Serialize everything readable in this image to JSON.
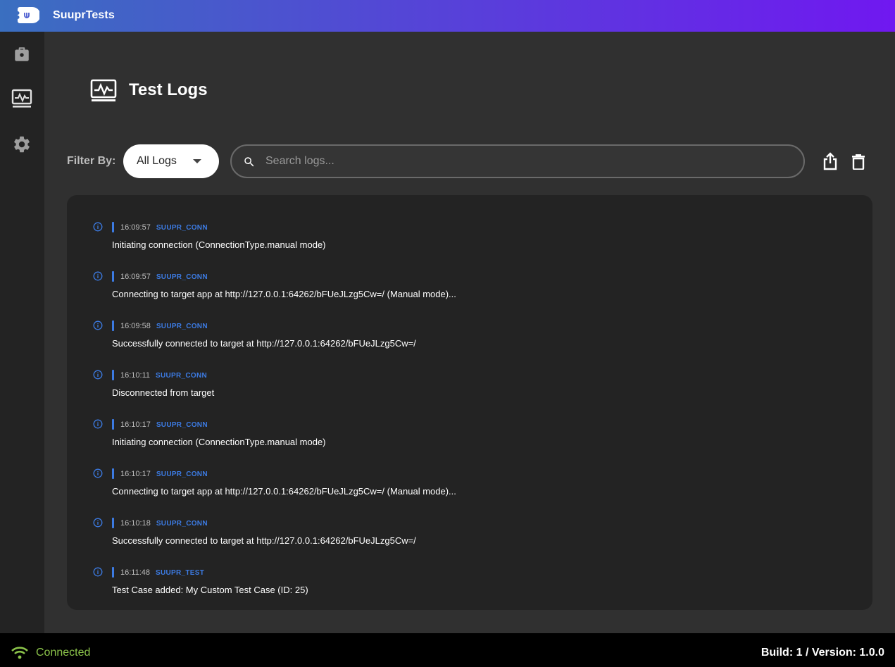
{
  "app": {
    "title": "SuuprTests",
    "accent": "#3c7be3",
    "gradient_start": "#3a6fc0",
    "gradient_end": "#7018f0"
  },
  "sidebar": {
    "items": [
      {
        "name": "test-cases",
        "icon": "briefcase-icon",
        "active": false
      },
      {
        "name": "test-logs",
        "icon": "monitor-heart-icon",
        "active": true
      },
      {
        "name": "settings",
        "icon": "gear-icon",
        "active": false
      }
    ]
  },
  "page": {
    "title": "Test Logs",
    "icon": "monitor-heart-icon"
  },
  "toolbar": {
    "filter_label": "Filter By:",
    "filter_value": "All Logs",
    "search_placeholder": "Search logs...",
    "search_value": "",
    "export_icon": "share-icon",
    "delete_icon": "trash-icon"
  },
  "logs": [
    {
      "time": "16:09:57",
      "tag": "SUUPR_CONN",
      "message": "Initiating connection (ConnectionType.manual mode)",
      "level": "info"
    },
    {
      "time": "16:09:57",
      "tag": "SUUPR_CONN",
      "message": "Connecting to target app at http://127.0.0.1:64262/bFUeJLzg5Cw=/ (Manual mode)...",
      "level": "info"
    },
    {
      "time": "16:09:58",
      "tag": "SUUPR_CONN",
      "message": "Successfully connected to target at http://127.0.0.1:64262/bFUeJLzg5Cw=/",
      "level": "info"
    },
    {
      "time": "16:10:11",
      "tag": "SUUPR_CONN",
      "message": "Disconnected from target",
      "level": "info"
    },
    {
      "time": "16:10:17",
      "tag": "SUUPR_CONN",
      "message": "Initiating connection (ConnectionType.manual mode)",
      "level": "info"
    },
    {
      "time": "16:10:17",
      "tag": "SUUPR_CONN",
      "message": "Connecting to target app at http://127.0.0.1:64262/bFUeJLzg5Cw=/ (Manual mode)...",
      "level": "info"
    },
    {
      "time": "16:10:18",
      "tag": "SUUPR_CONN",
      "message": "Successfully connected to target at http://127.0.0.1:64262/bFUeJLzg5Cw=/",
      "level": "info"
    },
    {
      "time": "16:11:48",
      "tag": "SUUPR_TEST",
      "message": "Test Case added: My Custom Test Case (ID: 25)",
      "level": "info"
    }
  ],
  "status": {
    "connection": "Connected",
    "connection_color": "#8bc34a",
    "version": "Build: 1 / Version: 1.0.0"
  }
}
